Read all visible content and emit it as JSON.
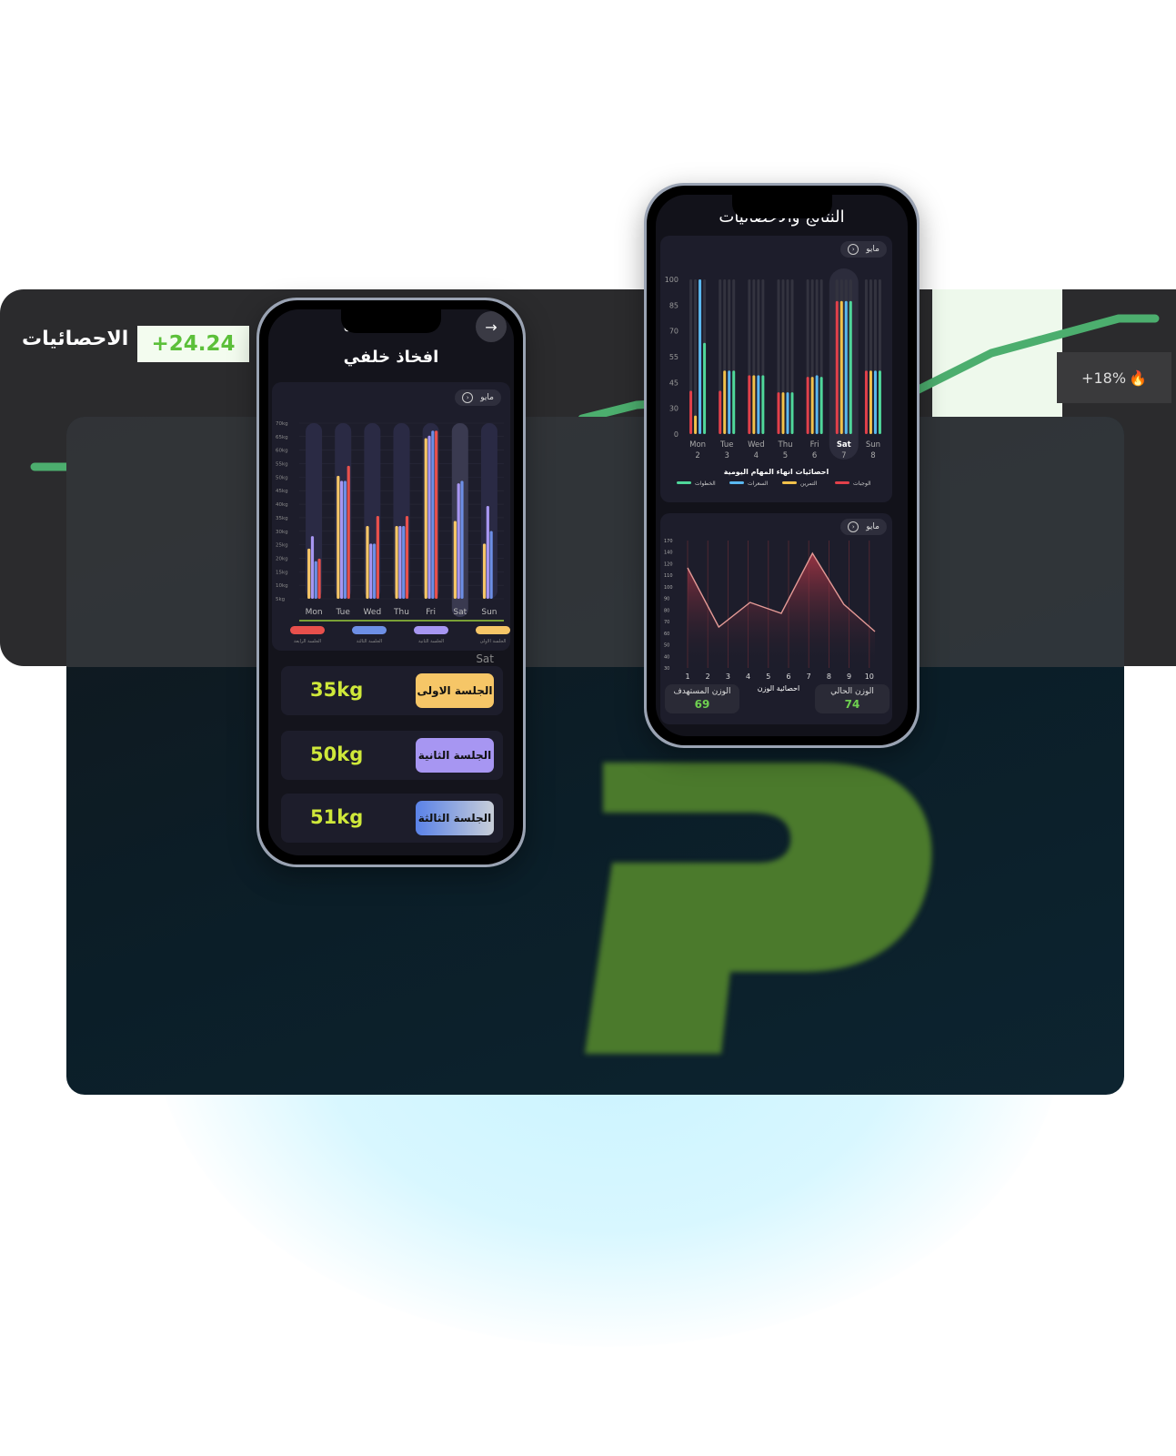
{
  "background": {
    "stats_title": "الاحصائيات",
    "delta_value": "+24.24",
    "pct_label": "+18%",
    "fire_icon": "fire-icon",
    "accent": "#4cae6e",
    "logo_letter": "P"
  },
  "phone_left": {
    "back_icon": "arrow-right-icon",
    "header_text": "احصائيات التمرين",
    "title": "افخاذ خلفي",
    "month_chip": "مايو",
    "y_ticks": [
      "70kg",
      "65kg",
      "60kg",
      "55kg",
      "50kg",
      "45kg",
      "40kg",
      "35kg",
      "30kg",
      "25kg",
      "20kg",
      "15kg",
      "10kg",
      "5kg"
    ],
    "legend": [
      "الجلسة الرابعة",
      "الجلسة الثالثة",
      "الجلسة الثانية",
      "الجلسة الاولى"
    ],
    "selected_day": "Sat",
    "sessions": [
      {
        "weight": "35kg",
        "label": "الجلسة الاولى",
        "color": "#f6c667"
      },
      {
        "weight": "50kg",
        "label": "الجلسة الثانية",
        "color": "#a796f2"
      },
      {
        "weight": "51kg",
        "label": "الجلسة الثالثة",
        "color": "#6d8fe6"
      }
    ]
  },
  "phone_right": {
    "title": "النتائج والاحصائيات",
    "month_chip_1": "مايو",
    "month_chip_2": "مايو",
    "chart1_title": "احصائيات انهاء المهام اليومية",
    "chart1_legend": [
      "الخطوات",
      "السعرات",
      "التمرين",
      "الوجبات"
    ],
    "chart2_title": "احصائية الوزن",
    "target_label": "الوزن المستهدف",
    "target_value": "69",
    "current_label": "الوزن الحالي",
    "current_value": "74"
  },
  "chart_data": [
    {
      "type": "bar",
      "title": "",
      "categories": [
        "Mon",
        "Tue",
        "Wed",
        "Thu",
        "Fri",
        "Sat",
        "Sun"
      ],
      "ylim": [
        0,
        70
      ],
      "y_unit": "kg",
      "series": [
        {
          "name": "الجلسة الاولى",
          "color": "#f6c667",
          "values": [
            20,
            49,
            29,
            29,
            64,
            31,
            22
          ]
        },
        {
          "name": "الجلسة الثانية",
          "color": "#a796f2",
          "values": [
            25,
            47,
            22,
            29,
            65,
            46,
            37
          ]
        },
        {
          "name": "الجلسة الثالثة",
          "color": "#6d8fe6",
          "values": [
            15,
            47,
            22,
            29,
            67,
            47,
            27
          ]
        },
        {
          "name": "الجلسة الرابعة",
          "color": "#e8504c",
          "values": [
            16,
            53,
            33,
            33,
            67,
            0,
            0
          ]
        }
      ]
    },
    {
      "type": "bar",
      "title": "احصائيات انهاء المهام اليومية",
      "categories": [
        "Mon 2",
        "Tue 3",
        "Wed 4",
        "Thu 5",
        "Fri 6",
        "Sat 7",
        "Sun 8"
      ],
      "y_ticks": [
        "0",
        "30",
        "45",
        "55",
        "70",
        "85",
        "100"
      ],
      "ylim": [
        0,
        100
      ],
      "series": [
        {
          "name": "الوجبات",
          "color": "#e2404a",
          "values": [
            28,
            28,
            38,
            27,
            37,
            86,
            41
          ]
        },
        {
          "name": "التمرين",
          "color": "#f2c14a",
          "values": [
            12,
            41,
            38,
            27,
            37,
            86,
            41
          ]
        },
        {
          "name": "السعرات",
          "color": "#5ab8f0",
          "values": [
            100,
            41,
            38,
            27,
            38,
            86,
            41
          ]
        },
        {
          "name": "الخطوات",
          "color": "#4fd79a",
          "values": [
            59,
            41,
            38,
            27,
            37,
            86,
            41
          ]
        }
      ]
    },
    {
      "type": "area",
      "title": "احصائية الوزن",
      "x": [
        1,
        2,
        3,
        4,
        5,
        6,
        7,
        8,
        9,
        10
      ],
      "y_ticks": [
        "170",
        "140",
        "120",
        "110",
        "100",
        "90",
        "80",
        "70",
        "60",
        "50",
        "40",
        "30"
      ],
      "series": [
        {
          "name": "",
          "color": "#e49a96",
          "values": [
            140,
            75,
            102,
            90,
            156,
            100,
            70
          ]
        }
      ]
    }
  ]
}
